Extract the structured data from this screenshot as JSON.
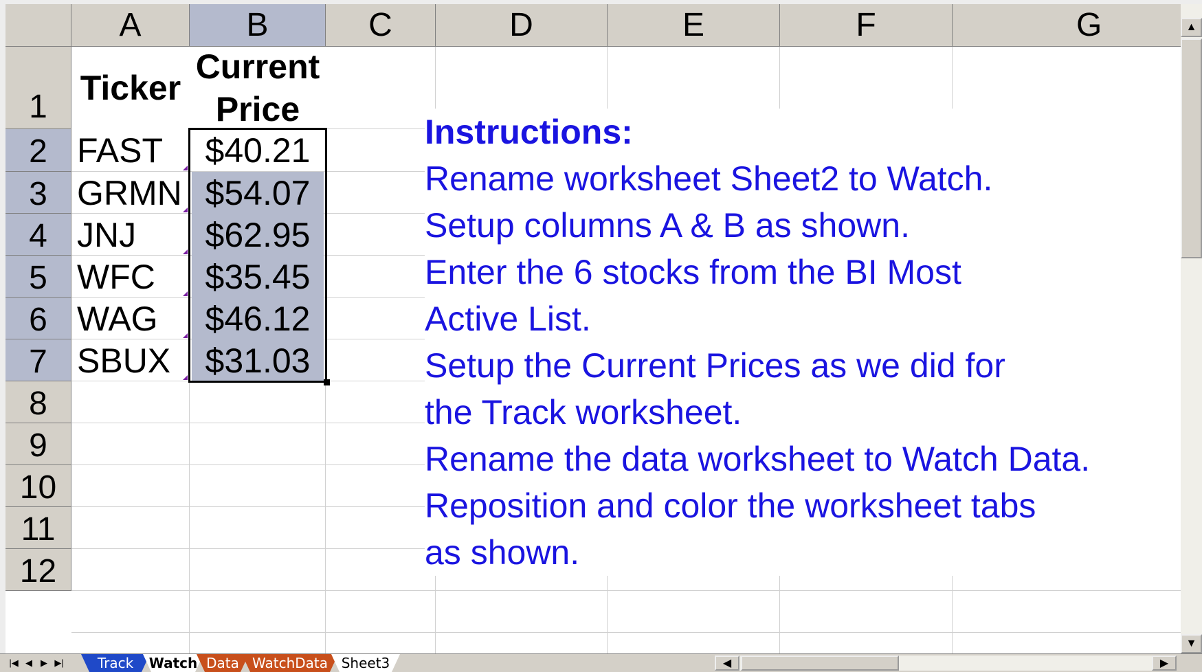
{
  "columns": [
    "A",
    "B",
    "C",
    "D",
    "E",
    "F",
    "G"
  ],
  "rows": [
    "1",
    "2",
    "3",
    "4",
    "5",
    "6",
    "7",
    "8",
    "9",
    "10",
    "11",
    "12"
  ],
  "header": {
    "ticker": "Ticker",
    "price_line1": "Current",
    "price_line2": "Price"
  },
  "stocks": [
    {
      "ticker": "FAST",
      "price": "$40.21"
    },
    {
      "ticker": "GRMN",
      "price": "$54.07"
    },
    {
      "ticker": "JNJ",
      "price": "$62.95"
    },
    {
      "ticker": "WFC",
      "price": "$35.45"
    },
    {
      "ticker": "WAG",
      "price": "$46.12"
    },
    {
      "ticker": "SBUX",
      "price": "$31.03"
    }
  ],
  "instructions": {
    "title": "Instructions:",
    "lines": [
      "Rename worksheet Sheet2 to Watch.",
      "Setup columns A & B as shown.",
      "Enter the 6 stocks from the BI Most",
      "Active List.",
      "Setup the Current Prices as we did for",
      "the Track worksheet.",
      "Rename the data worksheet to Watch Data.",
      "Reposition and color the worksheet tabs",
      "as shown."
    ]
  },
  "tabs": [
    {
      "label": "Track",
      "bg": "#1f49c8",
      "fg": "#ffffff",
      "active": false
    },
    {
      "label": "Watch",
      "bg": "#ffffff",
      "fg": "#000000",
      "active": true
    },
    {
      "label": "Data",
      "bg": "#c84f1b",
      "fg": "#ffffff",
      "active": false
    },
    {
      "label": "WatchData",
      "bg": "#c84f1b",
      "fg": "#ffffff",
      "active": false
    },
    {
      "label": "Sheet3",
      "bg": "#ffffff",
      "fg": "#000000",
      "active": false
    }
  ],
  "nav_icons": [
    "first-sheet-icon",
    "prev-sheet-icon",
    "next-sheet-icon",
    "last-sheet-icon"
  ],
  "colors": {
    "header_bg": "#d4d0c8",
    "selection": "#b4bacd",
    "instruction_text": "#1a14e0"
  }
}
